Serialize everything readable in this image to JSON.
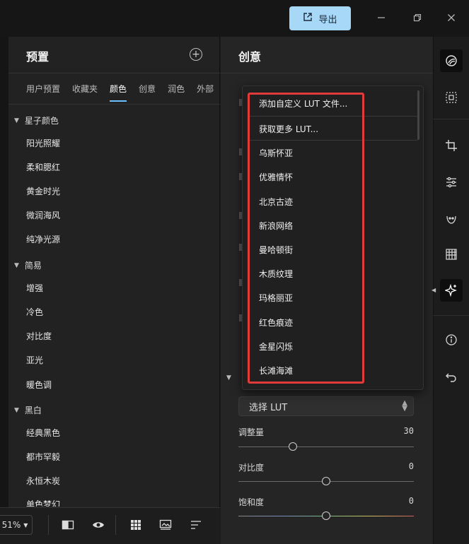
{
  "titlebar": {
    "export_label": "导出"
  },
  "presets_panel": {
    "title": "预置",
    "tabs": [
      "用户预置",
      "收藏夹",
      "颜色",
      "创意",
      "润色",
      "外部"
    ],
    "active_tab": "颜色",
    "groups": [
      {
        "name": "星子颜色",
        "items": [
          "阳光照耀",
          "柔和腮红",
          "黄金时光",
          "微润海风",
          "纯净光源"
        ]
      },
      {
        "name": "简易",
        "items": [
          "增强",
          "冷色",
          "对比度",
          "亚光",
          "暖色调"
        ]
      },
      {
        "name": "黑白",
        "items": [
          "经典黑色",
          "都市罕毅",
          "永恒木炭",
          "单色梦幻"
        ]
      }
    ]
  },
  "bottom_toolbar": {
    "zoom": "51%"
  },
  "edit_panel": {
    "title": "创意",
    "lut_select_label": "选择 LUT",
    "sliders": [
      {
        "label": "调整量",
        "value": "30",
        "position": 0.31
      },
      {
        "label": "对比度",
        "value": "0",
        "position": 0.5
      },
      {
        "label": "饱和度",
        "value": "0",
        "position": 0.5
      }
    ]
  },
  "lut_dropdown": {
    "add_custom": "添加自定义 LUT 文件...",
    "get_more": "获取更多 LUT...",
    "items": [
      "乌斯怀亚",
      "优雅情怀",
      "北京古迹",
      "新浪网络",
      "曼哈顿街",
      "木质纹理",
      "玛格丽亚",
      "红色痕迹",
      "金星闪烁",
      "长滩海滩"
    ]
  },
  "colors": {
    "accent": "#6cc0ff",
    "export_button": "#a8d8f8",
    "highlight": "#e03a3a"
  }
}
